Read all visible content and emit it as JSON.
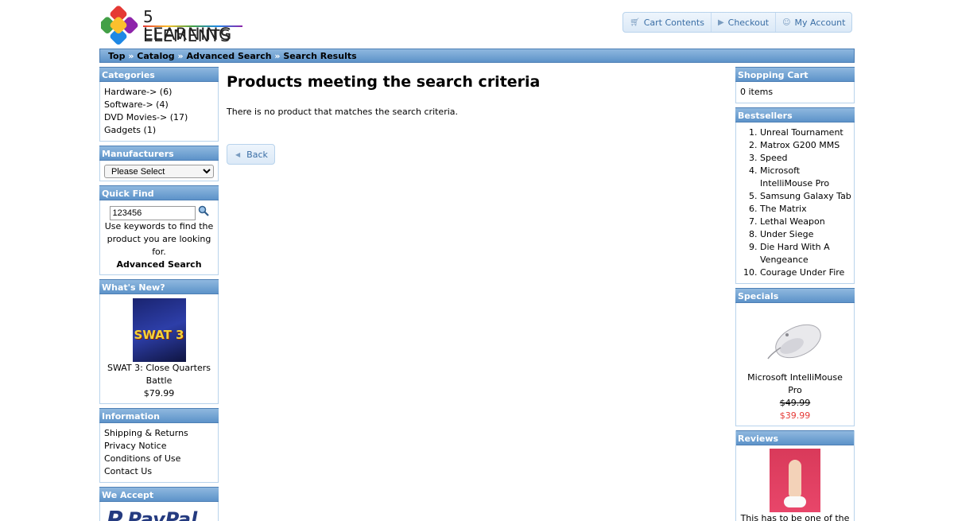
{
  "logo": {
    "line1": "5 ELEMENTS",
    "line2": "LEARNING"
  },
  "topnav": [
    {
      "label": "Cart Contents",
      "icon": "cart-icon"
    },
    {
      "label": "Checkout",
      "icon": "triangle-right-icon"
    },
    {
      "label": "My Account",
      "icon": "person-icon"
    }
  ],
  "breadcrumb": [
    "Top",
    "Catalog",
    "Advanced Search",
    "Search Results"
  ],
  "breadcrumb_separator": "»",
  "categories": {
    "title": "Categories",
    "items": [
      "Hardware-> (6)",
      "Software-> (4)",
      "DVD Movies-> (17)",
      "Gadgets (1)"
    ]
  },
  "manufacturers": {
    "title": "Manufacturers",
    "selected": "Please Select"
  },
  "quick_find": {
    "title": "Quick Find",
    "value": "123456",
    "hint": "Use keywords to find the product you are looking for.",
    "advanced": "Advanced Search"
  },
  "whats_new": {
    "title": "What's New?",
    "product": "SWAT 3: Close Quarters Battle",
    "price": "$79.99",
    "image_text": "SWAT 3"
  },
  "information": {
    "title": "Information",
    "items": [
      "Shipping & Returns",
      "Privacy Notice",
      "Conditions of Use",
      "Contact Us"
    ]
  },
  "we_accept": {
    "title": "We Accept",
    "logo": "PayPal"
  },
  "main": {
    "title": "Products meeting the search criteria",
    "message": "There is no product that matches the search criteria.",
    "back_label": "Back"
  },
  "shopping_cart": {
    "title": "Shopping Cart",
    "count": "0 items"
  },
  "bestsellers": {
    "title": "Bestsellers",
    "items": [
      "Unreal Tournament",
      "Matrox G200 MMS",
      "Speed",
      "Microsoft IntelliMouse Pro",
      "Samsung Galaxy Tab",
      "The Matrix",
      "Lethal Weapon",
      "Under Siege",
      "Die Hard With A Vengeance",
      "Courage Under Fire"
    ]
  },
  "specials": {
    "title": "Specials",
    "product": "Microsoft IntelliMouse Pro",
    "old_price": "$49.99",
    "new_price": "$39.99"
  },
  "reviews": {
    "title": "Reviews",
    "text": "This has to be one of the"
  },
  "colors": {
    "accent": "#5d93c9",
    "link": "#3a6ea5",
    "special": "#e53935"
  }
}
